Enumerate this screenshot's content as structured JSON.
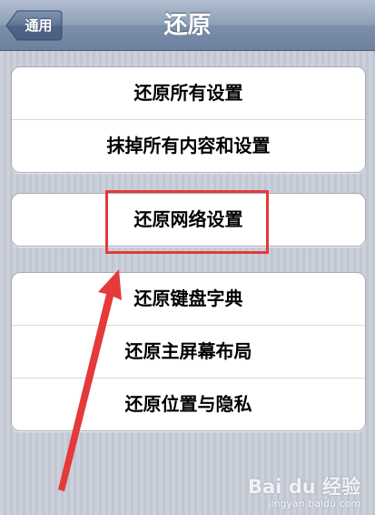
{
  "navbar": {
    "title": "还原",
    "back_label": "通用"
  },
  "groups": [
    {
      "items": [
        {
          "label": "还原所有设置"
        },
        {
          "label": "抹掉所有内容和设置"
        }
      ]
    },
    {
      "items": [
        {
          "label": "还原网络设置"
        }
      ]
    },
    {
      "items": [
        {
          "label": "还原键盘字典"
        },
        {
          "label": "还原主屏幕布局"
        },
        {
          "label": "还原位置与隐私"
        }
      ]
    }
  ],
  "annotation": {
    "color": "#e43a3a"
  },
  "watermark": {
    "logo": "Bai du 经验",
    "url": "jingyan.baidu.com"
  }
}
